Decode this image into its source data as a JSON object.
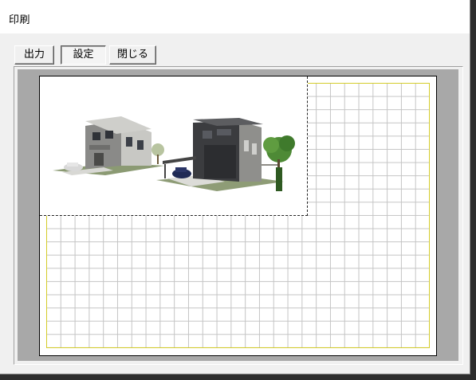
{
  "window": {
    "title": "印刷"
  },
  "toolbar": {
    "buttons": [
      {
        "label": "出力",
        "active": false
      },
      {
        "label": "設定",
        "active": true
      },
      {
        "label": "閉じる",
        "active": false
      }
    ]
  },
  "preview": {
    "image_content": "house-rendering",
    "colors": {
      "background": "#a8a8a8",
      "paper": "#ffffff",
      "grid": "#c4c4c4",
      "print_margin": "#d4cc2a",
      "selection_border": "#222222"
    }
  }
}
